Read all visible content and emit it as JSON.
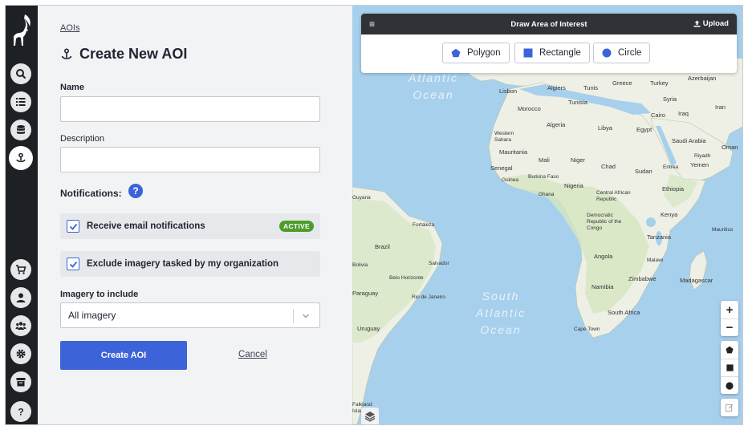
{
  "breadcrumb": {
    "label": "AOIs"
  },
  "page": {
    "title": "Create New AOI"
  },
  "form": {
    "name_label": "Name",
    "name_value": "",
    "description_label": "Description",
    "description_value": "",
    "notifications_label": "Notifications:",
    "help_glyph": "?",
    "email_notifications_label": "Receive email notifications",
    "email_notifications_checked": true,
    "active_badge": "ACTIVE",
    "exclude_label": "Exclude imagery tasked by my organization",
    "exclude_checked": true,
    "imagery_label": "Imagery to include",
    "imagery_value": "All imagery",
    "submit_label": "Create AOI",
    "cancel_label": "Cancel"
  },
  "draw_panel": {
    "title": "Draw Area of Interest",
    "menu_glyph": "≡",
    "upload_label": "Upload",
    "shapes": [
      {
        "label": "Polygon",
        "icon": "pentagon-icon"
      },
      {
        "label": "Rectangle",
        "icon": "square-icon"
      },
      {
        "label": "Circle",
        "icon": "circle-icon"
      }
    ]
  },
  "map": {
    "zoom_in": "+",
    "zoom_out": "−",
    "oceans": [
      "Atlantic Ocean",
      "South Atlantic Ocean"
    ],
    "labels": {
      "greece": "Greece",
      "turkey": "Turkey",
      "azerbaijan": "Azerbaijan",
      "algiers": "Algiers",
      "tunis": "Tunis",
      "lisbon": "Lisbon",
      "morocco": "Morocco",
      "tunisia": "Tunisia",
      "syria": "Syria",
      "iraq": "Iraq",
      "iran": "Iran",
      "cairo": "Cairo",
      "algeria": "Algeria",
      "libya": "Libya",
      "egypt": "Egypt",
      "western_sahara": "Western Sahara",
      "saudi_arabia": "Saudi Arabia",
      "oman": "Oman",
      "mauritania": "Mauritania",
      "mali": "Mali",
      "niger": "Niger",
      "chad": "Chad",
      "sudan": "Sudan",
      "eritrea": "Eritrea",
      "yemen": "Yemen",
      "senegal": "Senegal",
      "burkina_faso": "Burkina Faso",
      "guinea": "Guinea",
      "ghana": "Ghana",
      "nigeria": "Nigeria",
      "ethiopia": "Ethiopia",
      "car": "Central African Republic",
      "guyana": "Guyana",
      "drc": "Democratic Republic of the Congo",
      "kenya": "Kenya",
      "fortaleza": "Fortaleza",
      "tanzania": "Tanzania",
      "brazil": "Brazil",
      "salvador": "Salvador",
      "angola": "Angola",
      "malawi": "Malawi",
      "belo_horizonte": "Belo Horizonte",
      "zimbabwe": "Zimbabwe",
      "paraguay": "Paraguay",
      "rio": "Rio de Janeiro",
      "namibia": "Namibia",
      "madagascar": "Madagascar",
      "uruguay": "Uruguay",
      "south_africa": "South Africa",
      "cape_town": "Cape Town",
      "mauritius": "Mauritius",
      "riyadh": "Riyadh",
      "bolivia": "Bolivia",
      "falkland": "Falkland Islands"
    }
  }
}
